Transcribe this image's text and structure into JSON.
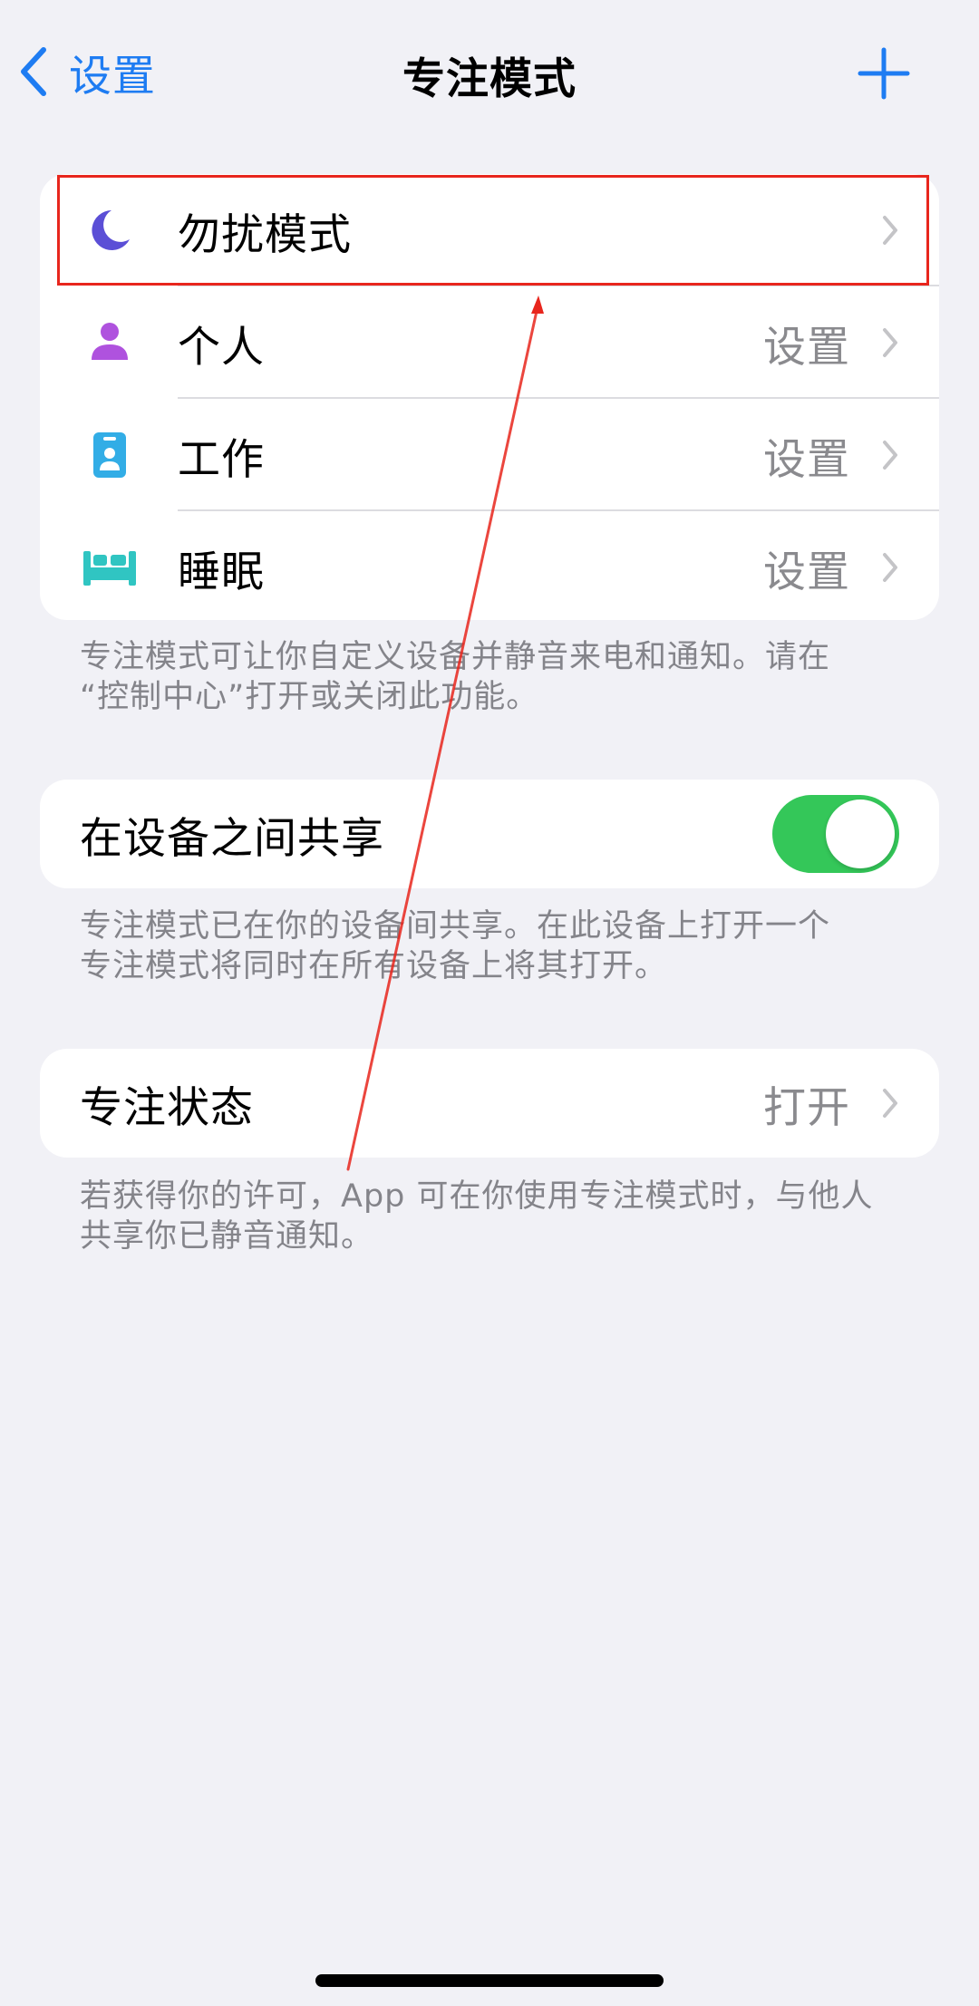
{
  "nav": {
    "back_label": "设置",
    "title": "专注模式"
  },
  "focus_modes": [
    {
      "label": "勿扰模式",
      "value": "",
      "icon": "moon-icon",
      "color": "#5b4fd6"
    },
    {
      "label": "个人",
      "value": "设置",
      "icon": "person-icon",
      "color": "#af52de"
    },
    {
      "label": "工作",
      "value": "设置",
      "icon": "id-badge-icon",
      "color": "#32ade6"
    },
    {
      "label": "睡眠",
      "value": "设置",
      "icon": "bed-icon",
      "color": "#30c5c2"
    }
  ],
  "focus_note": {
    "line1": "专注模式可让你自定义设备并静音来电和通知。请在",
    "line2": "“控制中心”打开或关闭此功能。"
  },
  "share": {
    "label": "在设备之间共享",
    "enabled": true,
    "note_line1": "专注模式已在你的设备间共享。在此设备上打开一个",
    "note_line2": "专注模式将同时在所有设备上将其打开。"
  },
  "status": {
    "label": "专注状态",
    "value": "打开",
    "note_line1": "若获得你的许可，App 可在你使用专注模式时，与他人",
    "note_line2": "共享你已静音通知。"
  },
  "colors": {
    "accent": "#1e7cf2",
    "toggle_on": "#34c759",
    "annotation": "#e8261d",
    "background": "#f1f1f6"
  }
}
